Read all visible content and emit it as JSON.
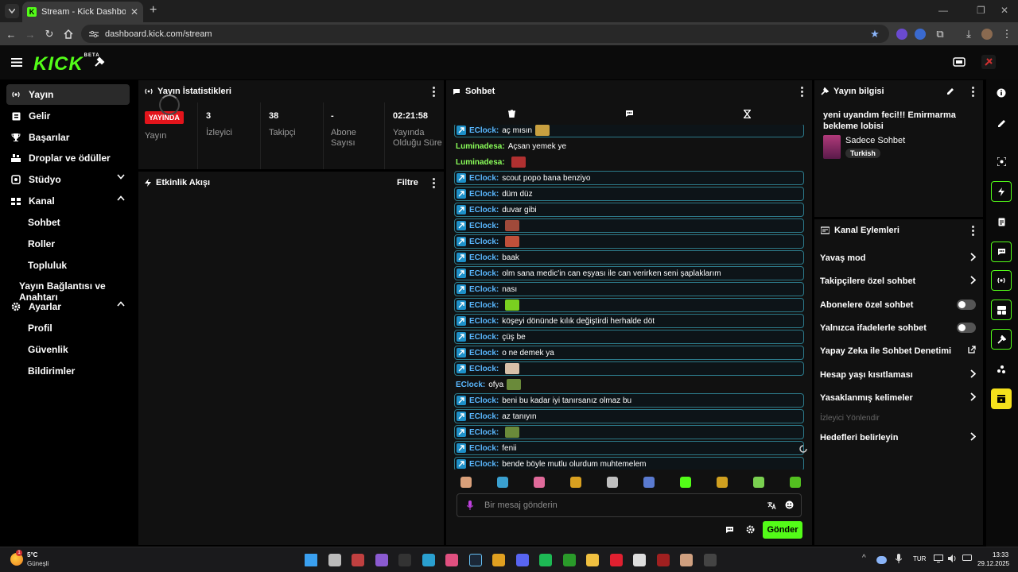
{
  "browser": {
    "tab_title": "Stream - Kick Dashboard",
    "url": "dashboard.kick.com/stream"
  },
  "logo": {
    "text": "KICK",
    "beta": "BETA"
  },
  "sidebar": {
    "items": [
      {
        "label": "Yayın",
        "icon": "broadcast-icon"
      },
      {
        "label": "Gelir",
        "icon": "revenue-icon"
      },
      {
        "label": "Başarılar",
        "icon": "trophy-icon"
      },
      {
        "label": "Droplar ve ödüller",
        "icon": "drops-icon"
      },
      {
        "label": "Stüdyo",
        "icon": "studio-icon"
      },
      {
        "label": "Kanal",
        "icon": "channel-icon"
      },
      {
        "label": "Ayarlar",
        "icon": "gear-icon"
      }
    ],
    "channel_sub": [
      "Sohbet",
      "Roller",
      "Topluluk",
      "Yayın Bağlantısı ve Anahtarı"
    ],
    "settings_sub": [
      "Profil",
      "Güvenlik",
      "Bildirimler"
    ]
  },
  "stats_panel": {
    "title": "Yayın İstatistikleri",
    "live_badge": "YAYINDA",
    "live_label": "Yayın",
    "stats": [
      {
        "value": "3",
        "label": "İzleyici"
      },
      {
        "value": "38",
        "label": "Takipçi"
      },
      {
        "value": "-",
        "label": "Abone Sayısı"
      },
      {
        "value": "02:21:58",
        "label": "Yayında Olduğu Süre"
      }
    ]
  },
  "activity_panel": {
    "title": "Etkinlik Akışı",
    "filter": "Filtre"
  },
  "chat": {
    "title": "Sohbet",
    "placeholder": "Bir mesaj gönderin",
    "send": "Gönder",
    "messages": [
      {
        "user": "EClock",
        "text": "aç mısın",
        "emote": "#c8a040",
        "boxed": true
      },
      {
        "user": "Luminadesa",
        "text": "Açsan yemek ye",
        "emote": null,
        "boxed": false
      },
      {
        "user": "Luminadesa",
        "text": "",
        "emote": "#b03030",
        "boxed": false
      },
      {
        "user": "EClock",
        "text": "scout popo bana benziyo",
        "emote": null,
        "boxed": true
      },
      {
        "user": "EClock",
        "text": "düm düz",
        "emote": null,
        "boxed": true
      },
      {
        "user": "EClock",
        "text": "duvar gibi",
        "emote": null,
        "boxed": true
      },
      {
        "user": "EClock",
        "text": "",
        "emote": "#a04a3a",
        "boxed": true
      },
      {
        "user": "EClock",
        "text": "",
        "emote": "#c0503a",
        "boxed": true
      },
      {
        "user": "EClock",
        "text": "baak",
        "emote": null,
        "boxed": true
      },
      {
        "user": "EClock",
        "text": "olm sana medic'in can eşyası ile can verirken seni şaplaklarım",
        "emote": null,
        "boxed": true
      },
      {
        "user": "EClock",
        "text": "nası",
        "emote": null,
        "boxed": true
      },
      {
        "user": "EClock",
        "text": "",
        "emote": "#7ad020",
        "boxed": true
      },
      {
        "user": "EClock",
        "text": "köşeyi dönünde kılık değiştirdi herhalde döt",
        "emote": null,
        "boxed": true
      },
      {
        "user": "EClock",
        "text": "çüş be",
        "emote": null,
        "boxed": true
      },
      {
        "user": "EClock",
        "text": "o ne demek ya",
        "emote": null,
        "boxed": true
      },
      {
        "user": "EClock",
        "text": "",
        "emote": "#d8c0a8",
        "boxed": true
      },
      {
        "user": "EClock",
        "text": "ofya",
        "emote": "#6a8a3a",
        "boxed": false
      },
      {
        "user": "EClock",
        "text": "beni bu kadar iyi tanırsanız olmaz bu",
        "emote": null,
        "boxed": true
      },
      {
        "user": "EClock",
        "text": "az tanıyın",
        "emote": null,
        "boxed": true
      },
      {
        "user": "EClock",
        "text": "",
        "emote": "#6a8a3a",
        "boxed": true
      },
      {
        "user": "EClock",
        "text": "fenii",
        "emote": null,
        "boxed": true
      },
      {
        "user": "EClock",
        "text": "bende böyle mutlu olurdum muhtemelem",
        "emote": null,
        "boxed": true
      }
    ],
    "emote_bar": [
      "#d9a07a",
      "#3aa0d0",
      "#e06a9a",
      "#d8a020",
      "#c0c0c0",
      "#5a7ad0",
      "#53fc18",
      "#d0a020",
      "#7ad050",
      "#53c020"
    ]
  },
  "stream_info": {
    "title": "Yayın bilgisi",
    "stream_title": "yeni uyandım feci!!! Emirmarma bekleme lobisi",
    "category": "Sadece Sohbet",
    "tag": "Turkish"
  },
  "channel_actions": {
    "title": "Kanal Eylemleri",
    "rows": [
      {
        "label": "Yavaş mod",
        "kind": "chevron"
      },
      {
        "label": "Takipçilere özel sohbet",
        "kind": "chevron"
      },
      {
        "label": "Abonelere özel sohbet",
        "kind": "toggle"
      },
      {
        "label": "Yalnızca ifadelerle sohbet",
        "kind": "toggle"
      },
      {
        "label": "Yapay Zeka ile Sohbet Denetimi",
        "kind": "external"
      },
      {
        "label": "Hesap yaşı kısıtlaması",
        "kind": "chevron"
      },
      {
        "label": "Yasaklanmış kelimeler",
        "kind": "chevron"
      },
      {
        "label": "İzleyici Yönlendir",
        "kind": "disabled"
      },
      {
        "label": "Hedefleri belirleyin",
        "kind": "chevron"
      }
    ]
  },
  "taskbar": {
    "weather_temp": "5°C",
    "weather_desc": "Güneşli",
    "weather_badge": "1",
    "lang": "TUR",
    "time": "13:33",
    "date": "29.12.2025"
  }
}
